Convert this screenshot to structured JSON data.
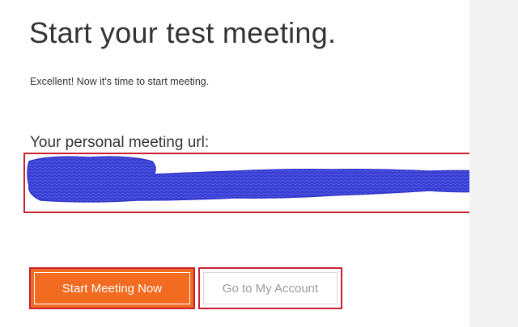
{
  "page": {
    "title": "Start your test meeting.",
    "subtitle": "Excellent! Now it's time to start meeting.",
    "url_label": "Your personal meeting url:",
    "url_value": ""
  },
  "buttons": {
    "start_label": "Start Meeting Now",
    "account_label": "Go to My Account"
  },
  "colors": {
    "accent_orange": "#f26b21",
    "highlight_red": "#c9202f",
    "redaction_blue": "#3a3fd4",
    "side_panel": "#f3f3f3"
  },
  "annotations": {
    "url_redacted": true
  }
}
